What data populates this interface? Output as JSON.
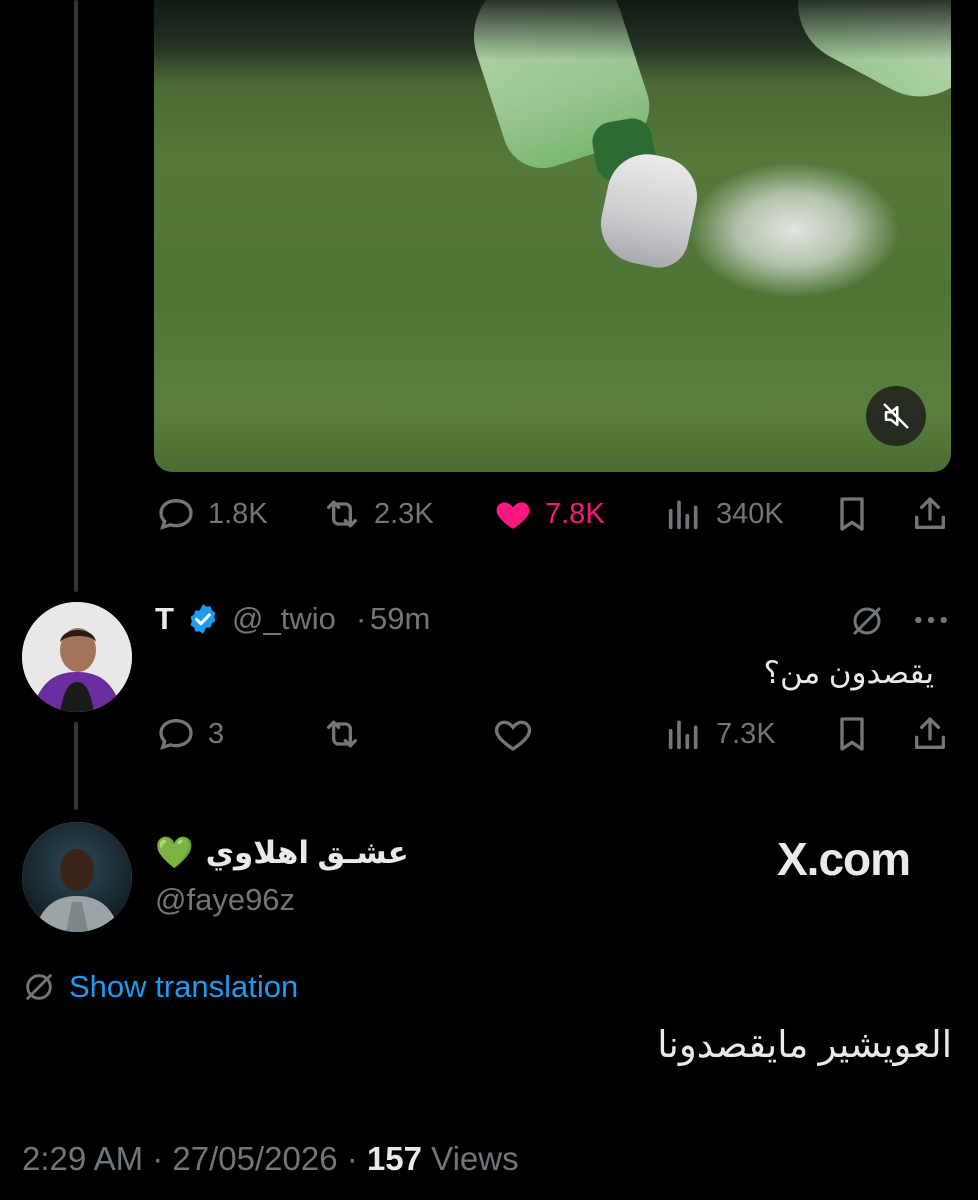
{
  "tweet": {
    "stats": {
      "replies": "1.8K",
      "reposts": "2.3K",
      "likes": "7.8K",
      "views": "340K"
    }
  },
  "reply": {
    "display_name": "T",
    "handle": "@_twio",
    "separator": "·",
    "time": "59m",
    "text": "يقصدون من؟",
    "stats": {
      "replies": "3",
      "views": "7.3K"
    }
  },
  "quote": {
    "display_name": "عشـق اهلاوي",
    "emoji": "💚",
    "handle": "@faye96z",
    "watermark": "X.com",
    "show_translation": "Show translation",
    "text": "العويشير مايقصدونا",
    "time": "2:29 AM",
    "separator": "·",
    "date": "27/05/2026",
    "views_count": "157",
    "views_label": "Views"
  },
  "colors": {
    "background": "#000000",
    "muted": "#71767b",
    "like": "#f91880",
    "link": "#1d9bf0",
    "verified": "#1d9bf0"
  },
  "icons": [
    "reply-icon",
    "repost-icon",
    "like-icon",
    "views-icon",
    "bookmark-icon",
    "share-icon",
    "mute-icon",
    "grok-icon",
    "more-icon",
    "translate-icon",
    "verified-icon"
  ]
}
